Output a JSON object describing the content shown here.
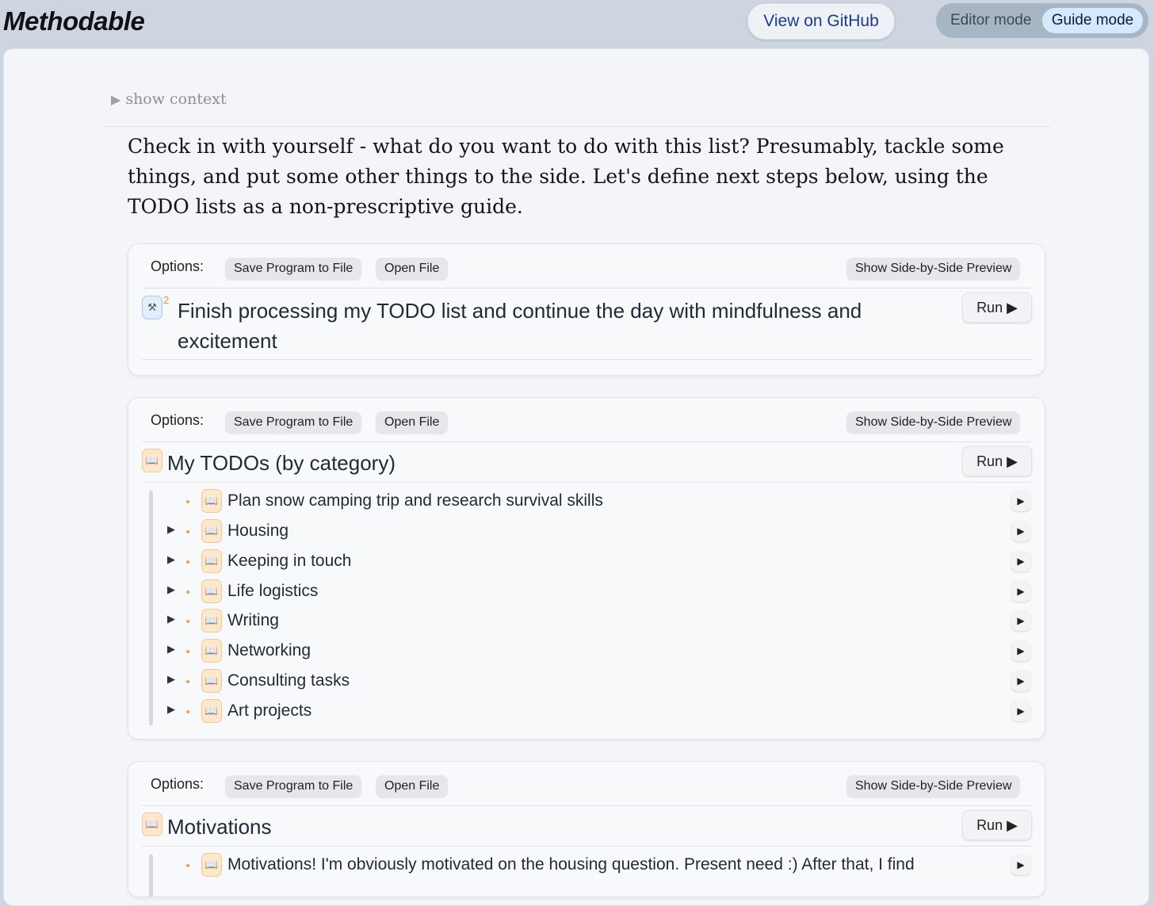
{
  "app": {
    "brand": "Methodable",
    "github_label": "View on GitHub",
    "mode_editor": "Editor mode",
    "mode_guide": "Guide mode",
    "active_mode": "Guide mode"
  },
  "context_toggle": "show context",
  "intro_text": "Check in with yourself - what do you want to do with this list? Presumably, tackle some things, and put some other things to the side. Let's define next steps below, using the TODO lists as a non-prescriptive guide.",
  "options": {
    "label": "Options:",
    "save": "Save Program to File",
    "open": "Open File",
    "preview": "Show Side-by-Side Preview"
  },
  "run_label": "Run ▶",
  "mini_run_glyph": "▶",
  "expand_glyph": "▶",
  "book_glyph": "📖",
  "step_glyph": "⚒",
  "cards": [
    {
      "title": "Finish processing my TODO list and continue the day with mindfulness and excitement",
      "superscript": "2",
      "icon": "step-icon"
    },
    {
      "title": "My TODOs (by category)",
      "icon": "book-icon",
      "items": [
        {
          "label": "Plan snow camping trip and research survival skills",
          "expandable": false
        },
        {
          "label": "Housing",
          "expandable": true
        },
        {
          "label": "Keeping in touch",
          "expandable": true
        },
        {
          "label": "Life logistics",
          "expandable": true
        },
        {
          "label": "Writing",
          "expandable": true
        },
        {
          "label": "Networking",
          "expandable": true
        },
        {
          "label": "Consulting tasks",
          "expandable": true
        },
        {
          "label": "Art projects",
          "expandable": true
        }
      ]
    },
    {
      "title": "Motivations",
      "icon": "book-icon",
      "items": [
        {
          "label": "Motivations! I'm obviously motivated on the housing question. Present need :) After that, I find",
          "expandable": false
        }
      ]
    }
  ],
  "colors": {
    "background": "#cdd6e0",
    "panel": "#f3f5f8",
    "accent_blue": "#1e3a8a",
    "book_icon_bg": "#fde8cc",
    "bullet": "#f0a14a"
  }
}
